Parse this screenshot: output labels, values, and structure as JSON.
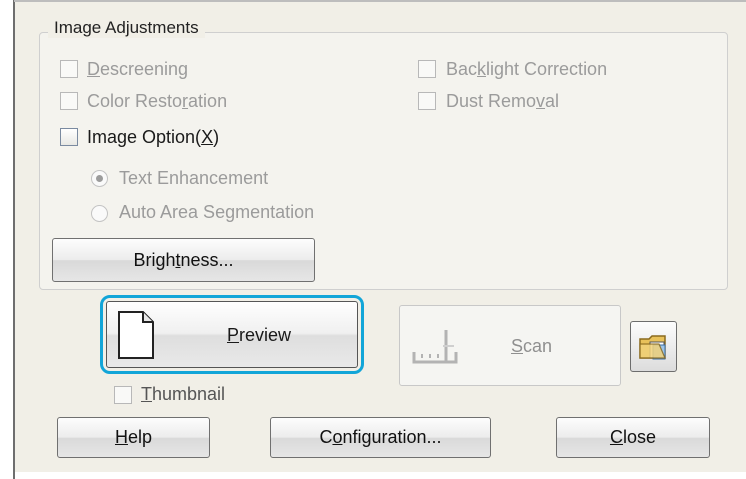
{
  "image_adjustments": {
    "title": "Image Adjustments",
    "descreening": {
      "label_pre": "",
      "label_u": "D",
      "label_post": "escreening",
      "checked": false,
      "enabled": false
    },
    "color_restoration": {
      "label_pre": "Color Resto",
      "label_u": "r",
      "label_post": "ation",
      "checked": false,
      "enabled": false
    },
    "backlight_correction": {
      "label_pre": "Bac",
      "label_u": "k",
      "label_post": "light Correction",
      "checked": false,
      "enabled": false
    },
    "dust_removal": {
      "label_pre": "Dust Remo",
      "label_u": "v",
      "label_post": "al",
      "checked": false,
      "enabled": false
    },
    "image_option": {
      "label_pre": "Image Option(",
      "label_u": "X",
      "label_post": ")",
      "checked": false,
      "enabled": true
    },
    "text_enhancement": {
      "label": "Text Enhancement",
      "selected": true,
      "enabled": false
    },
    "auto_area_segmentation": {
      "label": "Auto Area Segmentation",
      "selected": false,
      "enabled": false
    },
    "brightness_button": {
      "label_pre": "Brigh",
      "label_u": "t",
      "label_post": "ness..."
    }
  },
  "preview_button": {
    "label_pre": "",
    "label_u": "P",
    "label_post": "review",
    "icon": "document-icon"
  },
  "scan_button": {
    "label_pre": "",
    "label_u": "S",
    "label_post": "can",
    "icon": "scanner-icon",
    "enabled": false
  },
  "folder_button": {
    "icon": "folder-icon"
  },
  "thumbnail": {
    "label_pre": "",
    "label_u": "T",
    "label_post": "humbnail",
    "checked": false,
    "enabled": false
  },
  "footer": {
    "help": {
      "label_pre": "",
      "label_u": "H",
      "label_post": "elp"
    },
    "configuration": {
      "label_pre": "C",
      "label_u": "o",
      "label_post": "nfiguration..."
    },
    "close": {
      "label_pre": "",
      "label_u": "C",
      "label_post": "lose"
    }
  },
  "colors": {
    "focus_ring": "#12a5d8",
    "disabled_text": "#9b9b9b",
    "panel_bg": "#f1efe7"
  }
}
